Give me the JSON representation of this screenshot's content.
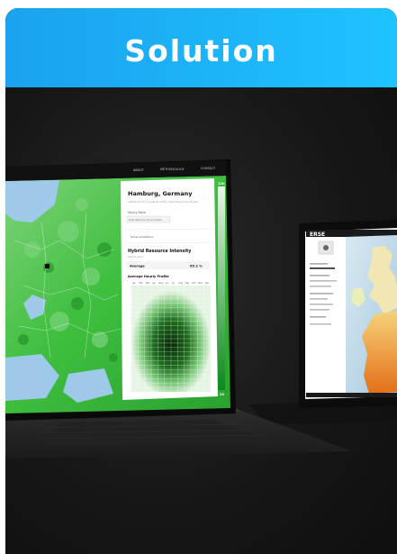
{
  "header": {
    "title": "Solution"
  },
  "colors": {
    "header_start": "#1ba2ee",
    "header_end": "#1ec3ff",
    "background": "#1a1a1a",
    "map_green": "#3fc93f",
    "heat_dark": "#0b3d0b"
  },
  "laptop_left": {
    "nav": [
      "ABOUT",
      "METHODOLOGY",
      "CONTACT"
    ],
    "panel": {
      "location": "Hamburg, Germany",
      "subtitle": "Latitude 53.55 | Longitude 10.00 | Hybrid Resource Intensity",
      "hourly_label": "Hourly Ratio",
      "select_value": "Solar Resource (Hourly Ratio)",
      "link": "Show Limitations",
      "section_title": "Hybrid Resource Intensity",
      "section_subtitle": "Solar & wind",
      "average_label": "Average",
      "average_value": "65.2 %",
      "profile_title": "Average Hourly Profile",
      "months": [
        "Jan",
        "Feb",
        "Mar",
        "Apr",
        "May",
        "Jun",
        "Jul",
        "Aug",
        "Sep",
        "Oct",
        "Nov",
        "Dec"
      ],
      "legend_top": "12h",
      "legend_bottom": "20"
    }
  },
  "laptop_right": {
    "logo": "ERSE",
    "legend_items": [
      "Resource Intensity",
      "Solar Resource",
      "Wind Resource",
      "Hybrid Resource",
      "Resource Intensity",
      "Solar Irradiance",
      "Wind Speed",
      "Capacity Factor",
      "Resource",
      "Export"
    ]
  }
}
